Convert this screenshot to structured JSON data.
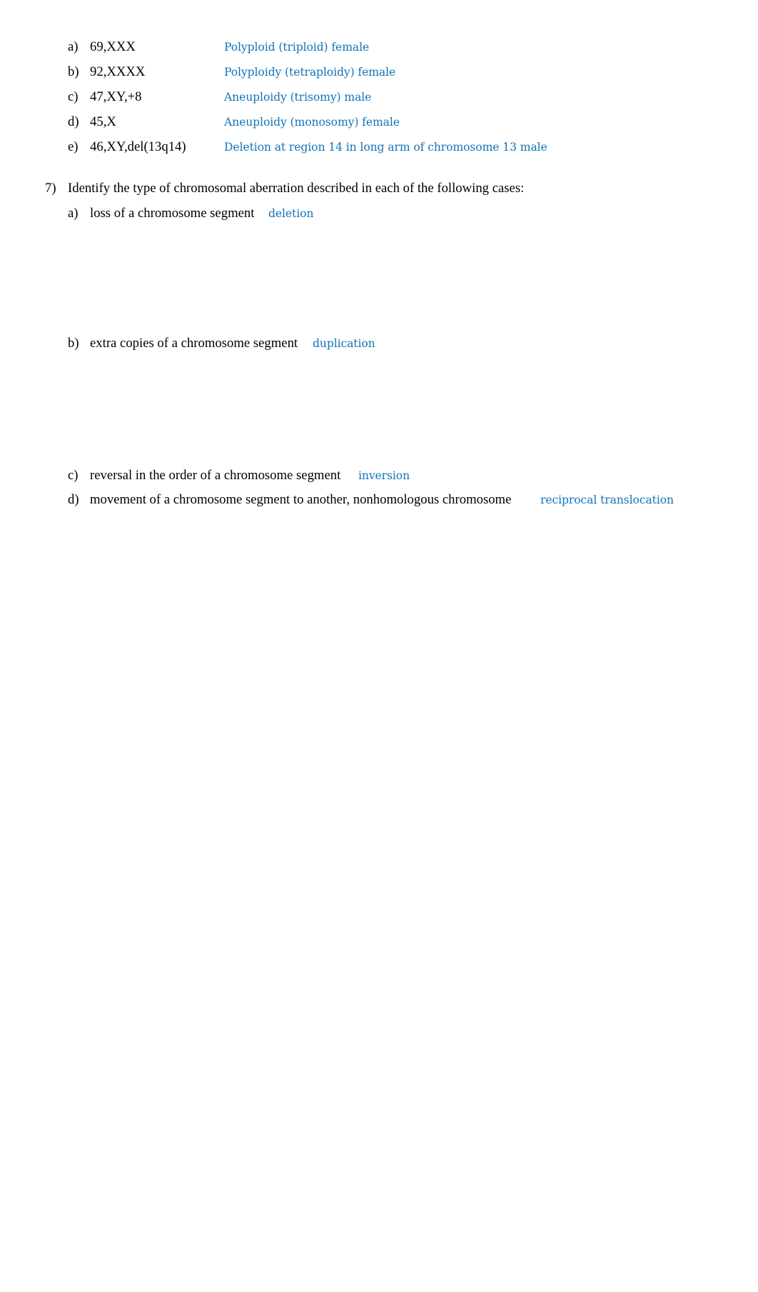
{
  "theme": {
    "answer_color": "#1174B9",
    "text_color": "#000000",
    "background": "#FFFFFF"
  },
  "question6": {
    "items": [
      {
        "label": "a)",
        "karyotype": "69,XXX",
        "answer": "Polyploid (triploid) female"
      },
      {
        "label": "b)",
        "karyotype": "92,XXXX",
        "answer": "Polyploidy (tetraploidy) female"
      },
      {
        "label": "c)",
        "karyotype": "47,XY,+8",
        "answer": "Aneuploidy (trisomy) male"
      },
      {
        "label": "d)",
        "karyotype": "45,X",
        "answer": "Aneuploidy (monosomy) female"
      },
      {
        "label": "e)",
        "karyotype": "46,XY,del(13q14)",
        "answer": "Deletion at region 14 in long arm of chromosome 13 male"
      }
    ]
  },
  "question7": {
    "number": "7)",
    "prompt": "Identify the type of chromosomal aberration described in each of the following cases:",
    "items": [
      {
        "label": "a)",
        "description": "loss of a chromosome segment",
        "answer": "deletion"
      },
      {
        "label": "b)",
        "description": "extra copies of a chromosome segment",
        "answer": "duplication"
      },
      {
        "label": "c)",
        "description": "reversal in the order of a chromosome segment",
        "answer": "inversion"
      },
      {
        "label": "d)",
        "description": "movement of a chromosome segment to another, nonhomologous chromosome",
        "answer": "reciprocal translocation"
      }
    ]
  }
}
